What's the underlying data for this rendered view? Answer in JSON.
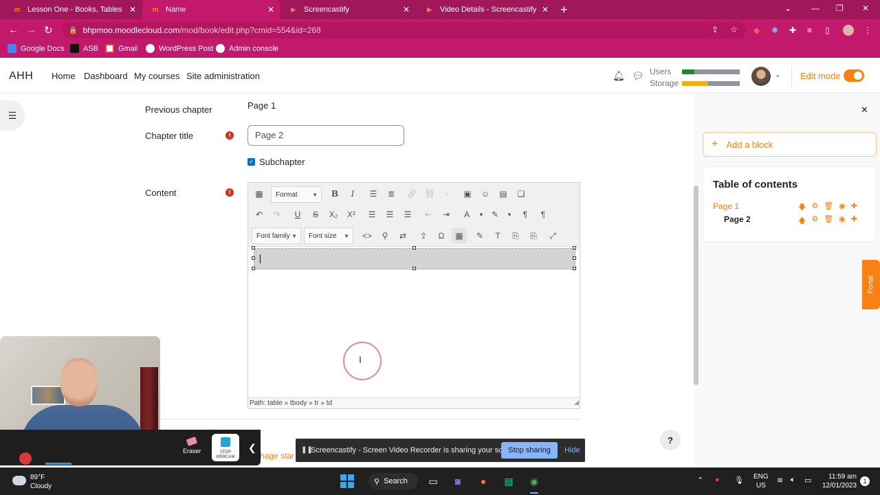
{
  "browser": {
    "tabs": [
      {
        "title": "Lesson One - Books, Tables and",
        "favicon": "moodle-icon"
      },
      {
        "title": "Name",
        "favicon": "moodle-icon"
      },
      {
        "title": "Screencastify",
        "favicon": "screencastify-icon"
      },
      {
        "title": "Video Details - Screencastify",
        "favicon": "screencastify-icon"
      }
    ],
    "active_tab_index": 1,
    "url_host": "bhpmoo.moodlecloud.com",
    "url_path": "/mod/book/edit.php?cmid=554&id=268",
    "bookmarks": [
      {
        "label": "Google Docs",
        "color": "#4285f4"
      },
      {
        "label": "ASB",
        "color": "#111111"
      },
      {
        "label": "Gmail",
        "color": "#ea4335"
      },
      {
        "label": "WordPress Post",
        "color": "#ffffff"
      },
      {
        "label": "Admin console",
        "color": "#ffffff"
      }
    ],
    "accent": "#c3196c"
  },
  "navbar": {
    "brand": "AHH",
    "links": [
      "Home",
      "Dashboard",
      "My courses",
      "Site administration"
    ],
    "quota_users_label": "Users",
    "quota_storage_label": "Storage",
    "quota_users_fraction": 0.22,
    "quota_storage_fraction": 0.45,
    "edit_mode_label": "Edit mode",
    "edit_mode_on": true
  },
  "form": {
    "previous_chapter_label": "Previous chapter",
    "previous_chapter_value": "Page 1",
    "chapter_title_label": "Chapter title",
    "chapter_title_value": "Page 2",
    "subchapter_label": "Subchapter",
    "subchapter_checked": true,
    "content_label": "Content",
    "required_icon": "!"
  },
  "editor": {
    "format_label": "Format",
    "font_family_label": "Font family",
    "font_size_label": "Font size",
    "path_text": "Path: table » tbody » tr » td"
  },
  "drawer": {
    "add_block_label": "Add a block",
    "toc_title": "Table of contents",
    "toc_items": [
      {
        "label": "Page 1",
        "current": false
      },
      {
        "label": "Page 2",
        "current": true
      }
    ],
    "portal_label": "Portal"
  },
  "help_label": "?",
  "partial_text": "hage star",
  "screencastify": {
    "eraser_label": "Eraser",
    "stop_webcam_label": "STOP WEBCAM",
    "share_message": "Screencastify - Screen Video Recorder is sharing your screen.",
    "stop_sharing_label": "Stop sharing",
    "hide_label": "Hide"
  },
  "taskbar": {
    "weather_temp": "89°F",
    "weather_desc": "Cloudy",
    "search_label": "Search",
    "lang_line1": "ENG",
    "lang_line2": "US",
    "time": "11:59 am",
    "date": "12/01/2023",
    "notif_count": "1"
  }
}
